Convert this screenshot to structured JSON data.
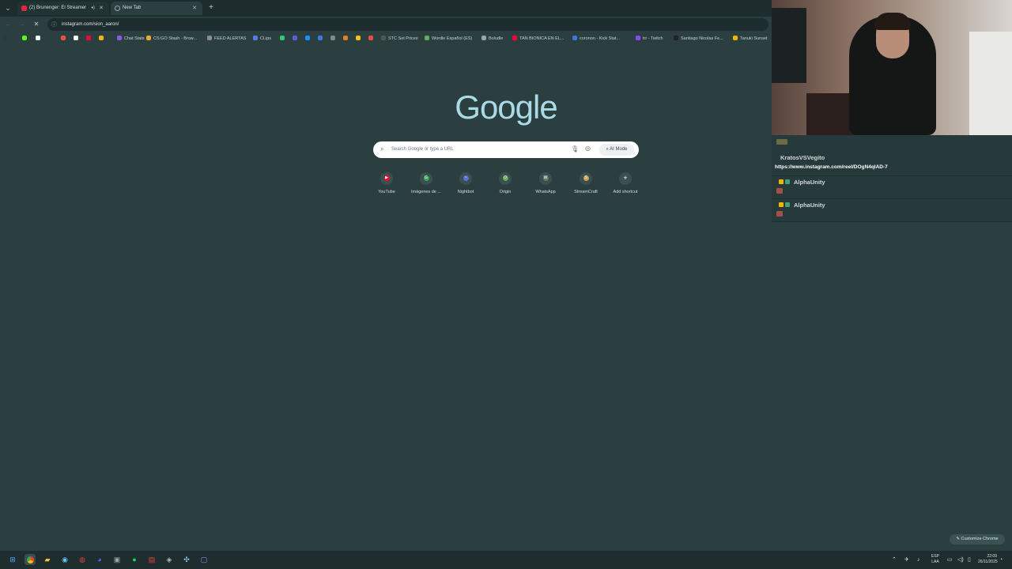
{
  "browser": {
    "tabs": [
      {
        "title": "(2) Brunenger: El Streamer",
        "favicon_color": "#e0263d",
        "active": false
      },
      {
        "title": "New Tab",
        "favicon_color": "#9aa6a6",
        "active": true
      }
    ],
    "new_tab_symbol": "+",
    "url": "instagram.com/sion_aaron/",
    "bookmarks": [
      {
        "label": "",
        "color": "#2d3b3b"
      },
      {
        "label": "",
        "color": "#53fc18"
      },
      {
        "label": "",
        "color": "#ffffff"
      },
      {
        "label": "",
        "color": "#e8553d"
      },
      {
        "label": "",
        "color": "#ffffff"
      },
      {
        "label": "",
        "color": "#ff0033"
      },
      {
        "label": "",
        "color": "#f4b400"
      },
      {
        "label": "Chat Stats",
        "color": "#8c5bd9"
      },
      {
        "label": "CS:GO Stash - Brow...",
        "color": "#f0a830"
      },
      {
        "label": "FEED ALERTAS",
        "color": "#8c8c8c"
      },
      {
        "label": "CLips",
        "color": "#5a7ae0"
      },
      {
        "label": "",
        "color": "#2ecc71"
      },
      {
        "label": "",
        "color": "#6a5acd"
      },
      {
        "label": "",
        "color": "#1e90ff"
      },
      {
        "label": "",
        "color": "#3a7bd5"
      },
      {
        "label": "",
        "color": "#888888"
      },
      {
        "label": "",
        "color": "#e67e22"
      },
      {
        "label": "",
        "color": "#f1c40f"
      },
      {
        "label": "",
        "color": "#e74c3c"
      },
      {
        "label": "STC Set Prices",
        "color": "#555555"
      },
      {
        "label": "Wordle Español (ES)",
        "color": "#6aaa64"
      },
      {
        "label": "Boludle",
        "color": "#9aa6a6"
      },
      {
        "label": "TAN BIONICA EN EL...",
        "color": "#ff0033"
      },
      {
        "label": "coronon - Kick Stat...",
        "color": "#3a7bd5"
      },
      {
        "label": "trr - Twitch",
        "color": "#9146ff"
      },
      {
        "label": "Santiago Nicolas Fe...",
        "color": "#222222"
      },
      {
        "label": "Tanuki Sunset",
        "color": "#f4b400"
      }
    ]
  },
  "ntp": {
    "logo_text": "Google",
    "search_placeholder": "Search Google or type a URL",
    "ai_mode_label": "AI Mode",
    "shortcuts": [
      {
        "name": "YouTube",
        "letter": "▶",
        "color": "#ff0033"
      },
      {
        "name": "Imágenes de ...",
        "letter": "G",
        "color": "#34a853"
      },
      {
        "name": "Nightbot",
        "letter": "~",
        "color": "#5b6fd6"
      },
      {
        "name": "Origin",
        "letter": "O",
        "color": "#6aa84f"
      },
      {
        "name": "WhatsApp",
        "letter": "W",
        "color": "#6b7b6f"
      },
      {
        "name": "StreamCraft",
        "letter": "S",
        "color": "#c8a152"
      },
      {
        "name": "Add shortcut",
        "letter": "+",
        "color": ""
      }
    ],
    "customize_label": "Customize Chrome"
  },
  "chat": {
    "messages": [
      {
        "user": "KratosVSVegito",
        "user_color": "#a8e060",
        "text": "https://www.instagram.com/reel/DOgN4qIAD-7"
      },
      {
        "user": "AlphaUnity",
        "user_color": "#c770ff",
        "text": ""
      },
      {
        "user": "AlphaUnity",
        "user_color": "#c770ff",
        "text": ""
      }
    ]
  },
  "taskbar": {
    "language": [
      "ESP",
      "LAA"
    ],
    "time": "22:09",
    "date": "26/11/2025"
  },
  "colors": {
    "page_bg": "#2b3f40",
    "accent": "#a9dbe6"
  }
}
